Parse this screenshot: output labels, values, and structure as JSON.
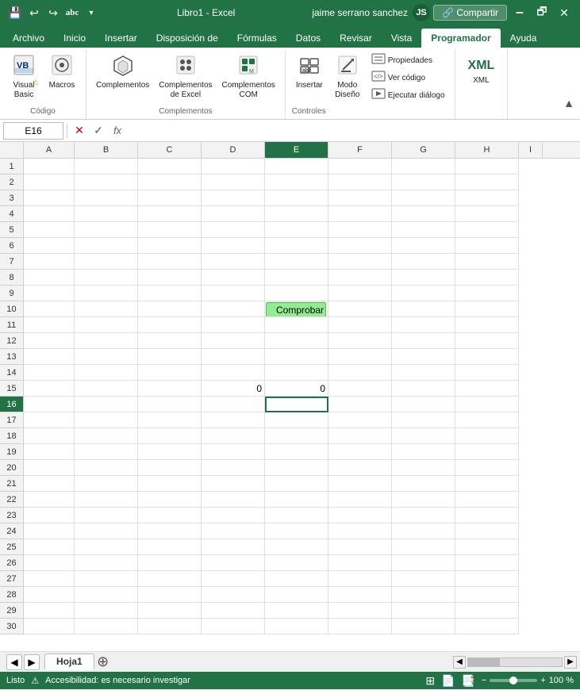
{
  "title_bar": {
    "filename": "Libro1 - Excel",
    "save_label": "💾",
    "undo_label": "↩",
    "redo_label": "↪",
    "spelling_label": "abc",
    "dropdown_label": "▾",
    "user_name": "jaime serrano sanchez",
    "user_initials": "JS",
    "minimize": "🗕",
    "restore": "🗗",
    "close": "✕"
  },
  "ribbon_tabs": [
    "Archivo",
    "Inicio",
    "Insertar",
    "Disposición de",
    "Fórmulas",
    "Datos",
    "Revisar",
    "Vista",
    "Programador",
    "Ayuda"
  ],
  "active_tab": "Programador",
  "ribbon": {
    "codigo_label": "Código",
    "complementos_label": "Complementos",
    "controles_label": "Controles",
    "groups": [
      {
        "name": "codigo",
        "label": "Código",
        "items": [
          {
            "id": "visual-basic",
            "icon": "📊",
            "label": "Visual\nBasic",
            "warn": true
          },
          {
            "id": "macros",
            "icon": "⏺",
            "label": "Macros",
            "warn": false
          }
        ]
      },
      {
        "name": "complementos",
        "label": "Complementos",
        "items": [
          {
            "id": "complementos",
            "icon": "⬡",
            "label": "Complementos"
          },
          {
            "id": "complementos-excel",
            "icon": "⚙",
            "label": "Complementos\nde Excel"
          },
          {
            "id": "complementos-com",
            "icon": "🧱",
            "label": "Complementos\nCOM"
          }
        ]
      },
      {
        "name": "controles",
        "label": "Controles",
        "items": [
          {
            "id": "insertar",
            "icon": "🔲",
            "label": "Insertar"
          },
          {
            "id": "modo-diseno",
            "icon": "✏",
            "label": "Modo\nDiseño"
          }
        ]
      },
      {
        "name": "xml",
        "label": "",
        "items": [
          {
            "id": "xml",
            "icon": "XML",
            "label": "XML"
          }
        ]
      }
    ],
    "collapse_icon": "▲"
  },
  "formula_bar": {
    "cell_ref": "E16",
    "cancel_icon": "✕",
    "confirm_icon": "✓",
    "fx_icon": "fx",
    "formula_value": ""
  },
  "columns": [
    "A",
    "B",
    "C",
    "D",
    "E",
    "F",
    "G",
    "H"
  ],
  "rows": [
    1,
    2,
    3,
    4,
    5,
    6,
    7,
    8,
    9,
    10,
    11,
    12,
    13,
    14,
    15,
    16,
    17,
    18,
    19,
    20,
    21,
    22,
    23,
    24,
    25,
    26,
    27,
    28,
    29,
    30
  ],
  "active_cell": {
    "row": 16,
    "col": "E"
  },
  "button": {
    "text": "Comprobar",
    "row": 10,
    "col": "E",
    "bg": "#90EE90",
    "border": "#5cb85c"
  },
  "cell_values": {
    "D15": "0",
    "E15": "0"
  },
  "sheet_tabs": [
    "Hoja1"
  ],
  "active_sheet": "Hoja1",
  "status_bar": {
    "ready": "Listo",
    "accessibility": "Accesibilidad: es necesario investigar",
    "zoom": "100 %"
  }
}
